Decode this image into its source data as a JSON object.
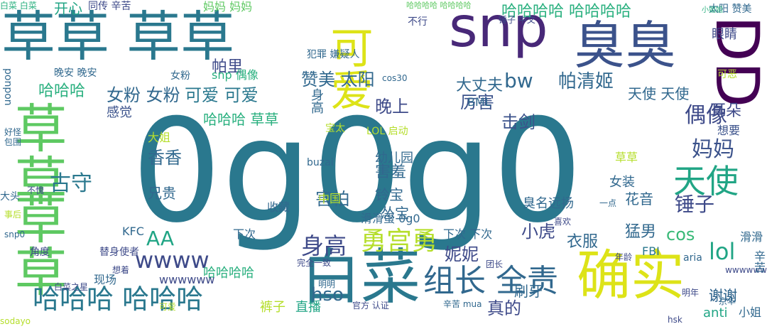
{
  "words": [
    {
      "text": "0g0g0",
      "color": "#2a788e"
    },
    {
      "text": "草草 草草",
      "color": "#2a788e"
    },
    {
      "text": "snp",
      "color": "#482878"
    },
    {
      "text": "臭臭",
      "color": "#3b528b"
    },
    {
      "text": "DD",
      "color": "#440154"
    },
    {
      "text": "草草",
      "color": "#5ec962"
    },
    {
      "text": "草草",
      "color": "#5ec962"
    },
    {
      "text": "白菜",
      "color": "#2a788e"
    },
    {
      "text": "确实",
      "color": "#dde318"
    },
    {
      "text": "可爱",
      "color": "#dde318"
    },
    {
      "text": "哈哈哈 哈哈哈",
      "color": "#2a788e"
    },
    {
      "text": "组长 全责",
      "color": "#31688e"
    },
    {
      "text": "天使",
      "color": "#21a585"
    },
    {
      "text": "勇宫勇",
      "color": "#b5de2b"
    },
    {
      "text": "wwww",
      "color": "#3e4a89"
    },
    {
      "text": "身高",
      "color": "#3e4a89"
    },
    {
      "text": "偶像",
      "color": "#3e4a89"
    },
    {
      "text": "妈妈",
      "color": "#3b528b"
    },
    {
      "text": "锤子",
      "color": "#3e4a89"
    },
    {
      "text": "古守",
      "color": "#2a788e"
    },
    {
      "text": "哈哈哈哈 哈哈哈哈",
      "color": "#2ab07f"
    },
    {
      "text": "赞美 太阳",
      "color": "#31688e"
    },
    {
      "text": "女粉 女粉",
      "color": "#31688e"
    },
    {
      "text": "可爱 可爱",
      "color": "#2a788e"
    },
    {
      "text": "击剑",
      "color": "#3b528b"
    },
    {
      "text": "帕清姬",
      "color": "#31688e"
    },
    {
      "text": "天使 天使",
      "color": "#31688e"
    },
    {
      "text": "耳朵",
      "color": "#3e4a89"
    },
    {
      "text": "谢谢",
      "color": "#3e4a89"
    },
    {
      "text": "lol",
      "color": "#21a585"
    },
    {
      "text": "cos",
      "color": "#38b977"
    },
    {
      "text": "真的",
      "color": "#3e4a89"
    },
    {
      "text": "hso",
      "color": "#31688e"
    },
    {
      "text": "妮妮",
      "color": "#3e4a89"
    },
    {
      "text": "害怕",
      "color": "#31688e"
    },
    {
      "text": "害羞",
      "color": "#31688e"
    },
    {
      "text": "香香",
      "color": "#31688e"
    },
    {
      "text": "晚上",
      "color": "#3e4a89"
    },
    {
      "text": "大丈夫",
      "color": "#31688e"
    },
    {
      "text": "厉害",
      "color": "#3b528b"
    },
    {
      "text": "bw",
      "color": "#31688e"
    },
    {
      "text": "哈哈哈 草草",
      "color": "#2ab07f"
    },
    {
      "text": "哈哈哈",
      "color": "#2ab07f"
    },
    {
      "text": "AA",
      "color": "#21a585"
    },
    {
      "text": "小虎",
      "color": "#3e4a89"
    },
    {
      "text": "猛男",
      "color": "#31688e"
    },
    {
      "text": "衣服",
      "color": "#31688e"
    },
    {
      "text": "花音",
      "color": "#31688e"
    },
    {
      "text": "铃宝",
      "color": "#31688e"
    },
    {
      "text": "幼儿园",
      "color": "#31688e"
    },
    {
      "text": "怂宝",
      "color": "#31688e"
    },
    {
      "text": "兄贵",
      "color": "#31688e"
    },
    {
      "text": "感觉",
      "color": "#3b528b"
    },
    {
      "text": "帕里",
      "color": "#3e4a89"
    },
    {
      "text": "开心",
      "color": "#21a585"
    },
    {
      "text": "妈妈 妈妈",
      "color": "#5ec962"
    },
    {
      "text": "哈哈哈哈",
      "color": "#2ab07f"
    },
    {
      "text": "直播",
      "color": "#21a585"
    },
    {
      "text": "裤子",
      "color": "#b5de2b"
    },
    {
      "text": "刷牙",
      "color": "#31688e"
    },
    {
      "text": "眼睛",
      "color": "#3e4a89"
    },
    {
      "text": "想要",
      "color": "#3b528b"
    },
    {
      "text": "谢谢",
      "color": "#31688e"
    },
    {
      "text": "anti",
      "color": "#21a585"
    },
    {
      "text": "小姐",
      "color": "#31688e"
    },
    {
      "text": "FBI",
      "color": "#2a788e"
    },
    {
      "text": "aria",
      "color": "#31688e"
    },
    {
      "text": "宝太",
      "color": "#b5de2b"
    },
    {
      "text": "大姐",
      "color": "#b5de2b"
    },
    {
      "text": "草草",
      "color": "#b5de2b"
    },
    {
      "text": "KFC",
      "color": "#31688e"
    },
    {
      "text": "下次",
      "color": "#31688e"
    },
    {
      "text": "下次 下次",
      "color": "#31688e"
    },
    {
      "text": "滑滑蛋 0g0",
      "color": "#31688e"
    },
    {
      "text": "收藏",
      "color": "#31688e"
    },
    {
      "text": "中国",
      "color": "#b5de2b"
    },
    {
      "text": "buzai",
      "color": "#31688e"
    },
    {
      "text": "LOL 启动",
      "color": "#b5de2b"
    },
    {
      "text": "BML",
      "color": "#31688e"
    },
    {
      "text": "晚安 晚安",
      "color": "#31688e"
    },
    {
      "text": "snp 偶像",
      "color": "#2ab07f"
    },
    {
      "text": "女粉",
      "color": "#31688e"
    },
    {
      "text": "犯罪 嫌疑人",
      "color": "#31688e"
    },
    {
      "text": "cos30",
      "color": "#31688e"
    },
    {
      "text": "不行",
      "color": "#3e4a89"
    },
    {
      "text": "白菜 白菜",
      "color": "#2ab07f"
    },
    {
      "text": "同传 辛苦",
      "color": "#3e4a89"
    },
    {
      "text": "太阳 赞美",
      "color": "#31688e"
    },
    {
      "text": "哈哈哈哈 哈哈哈哈",
      "color": "#5ec962"
    },
    {
      "text": "锤子 中文",
      "color": "#3e4a89"
    },
    {
      "text": "小姐姐",
      "color": "#2ab07f"
    },
    {
      "text": "sodayo",
      "color": "#b5de2b"
    },
    {
      "text": "白菜之星",
      "color": "#3e4a89"
    },
    {
      "text": "现场",
      "color": "#31688e"
    },
    {
      "text": "想着",
      "color": "#3e4a89"
    },
    {
      "text": "替身使者",
      "color": "#3e4a89"
    },
    {
      "text": "角度",
      "color": "#3e4a89"
    },
    {
      "text": "snp0",
      "color": "#31688e"
    },
    {
      "text": "事后",
      "color": "#b5de2b"
    },
    {
      "text": "大头",
      "color": "#31688e"
    },
    {
      "text": "不愧",
      "color": "#3e4a89"
    },
    {
      "text": "好怪",
      "color": "#31688e"
    },
    {
      "text": "包围",
      "color": "#31688e"
    },
    {
      "text": "ponpon",
      "color": "#31688e"
    },
    {
      "text": "完全一致",
      "color": "#3e4a89"
    },
    {
      "text": "明明",
      "color": "#31688e"
    },
    {
      "text": "wwwwww",
      "color": "#3e4a89"
    },
    {
      "text": "官方 认证",
      "color": "#3e4a89"
    },
    {
      "text": "辛苦 mua",
      "color": "#31688e"
    },
    {
      "text": "hsk",
      "color": "#3e4a89"
    },
    {
      "text": "京华",
      "color": "#31688e"
    },
    {
      "text": "明年",
      "color": "#3e4a89"
    },
    {
      "text": "wwwwww",
      "color": "#3e4a89"
    },
    {
      "text": "团长",
      "color": "#3e4a89"
    },
    {
      "text": "年龄",
      "color": "#3e4a89"
    },
    {
      "text": "喜欢",
      "color": "#3e4a89"
    },
    {
      "text": "臭名远扬",
      "color": "#31688e"
    },
    {
      "text": "一点",
      "color": "#31688e"
    },
    {
      "text": "女装",
      "color": "#31688e"
    },
    {
      "text": "辛苦",
      "color": "#31688e"
    },
    {
      "text": "可恶",
      "color": "#b5de2b"
    },
    {
      "text": "滑滑",
      "color": "#31688e"
    },
    {
      "text": "身高",
      "color": "#31688e"
    },
    {
      "text": "可爱",
      "color": "#b5de2b"
    }
  ]
}
